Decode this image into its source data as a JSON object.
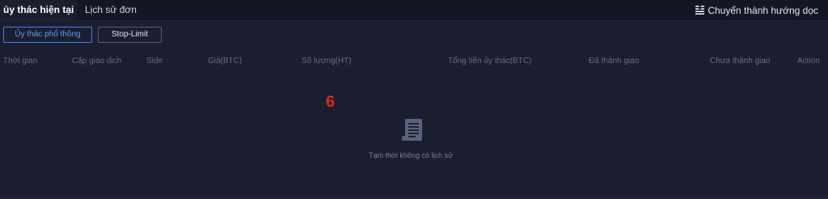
{
  "tabs": {
    "current": "ủy thác hiện tại",
    "history": "Lịch sử đơn"
  },
  "layout_toggle": {
    "label": "Chuyển thành hướng dọc",
    "icon": "layout-columns-icon"
  },
  "order_type_buttons": {
    "normal": "Ủy thác phổ thông",
    "stop_limit": "Stop-Limit"
  },
  "table": {
    "headers": [
      "Thời gian",
      "Cặp giao dịch",
      "Side",
      "Giá(BTC)",
      "Số lượng(HT)",
      "Tổng tiền ủy thác(BTC)",
      "Đã thành giao",
      "Chưa thành giao",
      "Action"
    ]
  },
  "annotation": "6",
  "empty_state": {
    "icon": "document-icon",
    "message": "Tạm thời không có lịch sử"
  },
  "colors": {
    "background": "#1b1e2f",
    "tabbar": "#141624",
    "accent": "#3b82f6",
    "annotation": "#e42424"
  }
}
